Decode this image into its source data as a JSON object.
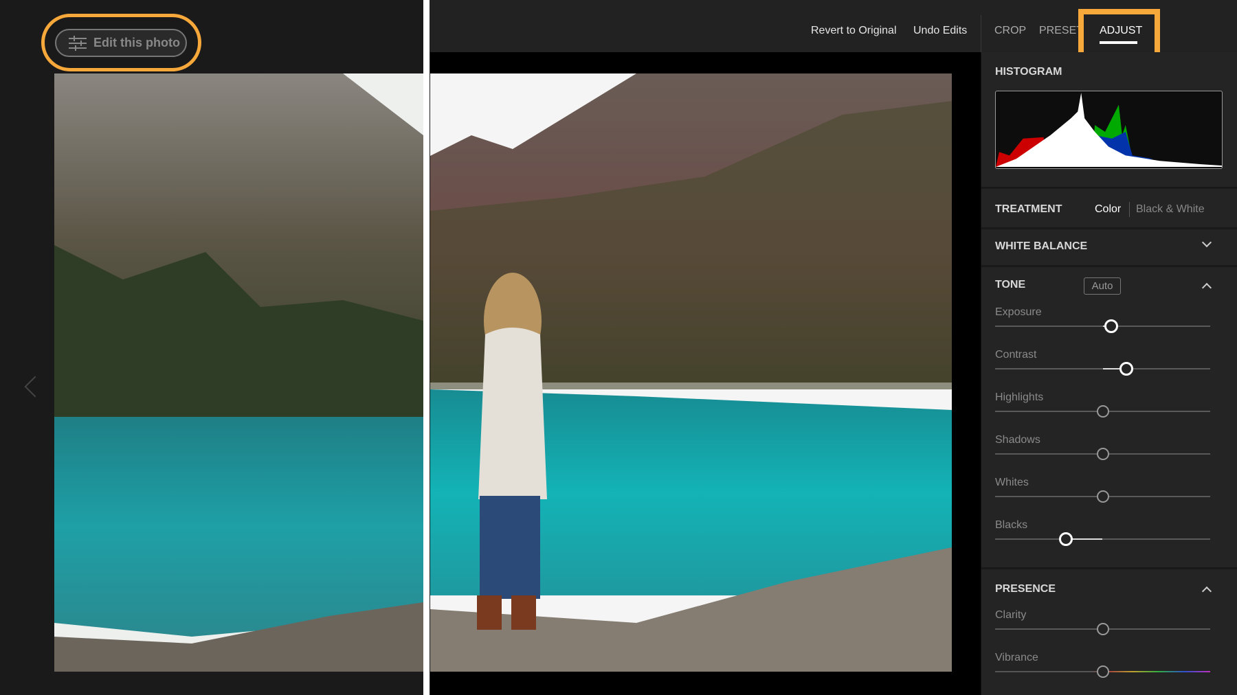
{
  "edit_button": {
    "label": "Edit this photo",
    "icon": "sliders-icon"
  },
  "toolbar": {
    "revert": "Revert to Original",
    "undo": "Undo Edits"
  },
  "tabs": [
    {
      "label": "CROP"
    },
    {
      "label": "PRESETS"
    },
    {
      "label": "ADJUST",
      "active": true
    }
  ],
  "highlight_color": "#F7A83A",
  "panel": {
    "histogram": "HISTOGRAM",
    "treatment": {
      "label": "TREATMENT",
      "options": [
        "Color",
        "Black & White"
      ],
      "selected": "Color"
    },
    "white_balance": "WHITE BALANCE",
    "tone": {
      "label": "TONE",
      "auto": "Auto",
      "sliders": [
        {
          "label": "Exposure",
          "value": 0.54
        },
        {
          "label": "Contrast",
          "value": 0.61
        },
        {
          "label": "Highlights",
          "value": 0.5
        },
        {
          "label": "Shadows",
          "value": 0.5
        },
        {
          "label": "Whites",
          "value": 0.5
        },
        {
          "label": "Blacks",
          "value": 0.33
        }
      ]
    },
    "presence": {
      "label": "PRESENCE",
      "sliders": [
        {
          "label": "Clarity",
          "value": 0.5
        },
        {
          "label": "Vibrance",
          "value": 0.5
        }
      ]
    }
  }
}
